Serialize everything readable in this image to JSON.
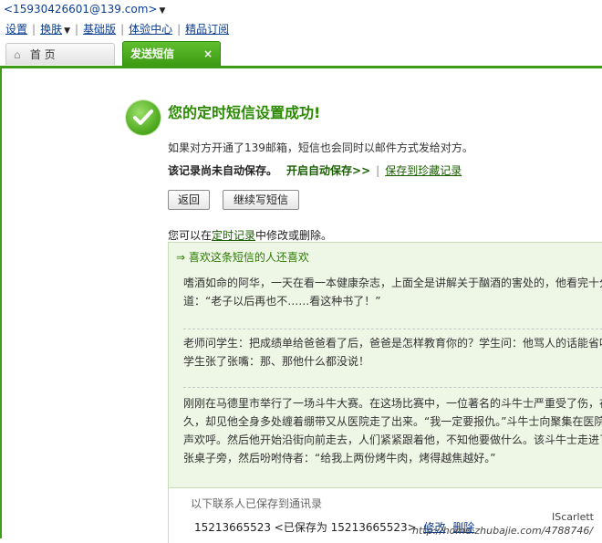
{
  "account": {
    "email": "<15930426601@139.com>"
  },
  "topnav": {
    "items": [
      "设置",
      "换肤",
      "基础版",
      "体验中心",
      "精品订阅"
    ]
  },
  "tabs": {
    "home": "首 页",
    "sms": "发送短信",
    "close": "×"
  },
  "success": {
    "title": "您的定时短信设置成功!",
    "line1": "如果对方开通了139邮箱，短信也会同时以邮件方式发给对方。",
    "not_saved": "该记录尚未自动保存。",
    "auto_save": "开启自动保存>>",
    "save_favorites": "保存到珍藏记录"
  },
  "buttons": {
    "back": "返回",
    "continue": "继续写短信"
  },
  "edit_note": {
    "prefix": "您可以在",
    "link": "定时记录",
    "suffix": "中修改或删除。"
  },
  "recommend": {
    "title": "⇒ 喜欢这条短信的人还喜欢",
    "jokes": [
      [
        "嗜酒如命的阿华，一天在看一本健康杂志，上面全是讲解关于酗酒的害处的，他看完十分",
        "道：“老子以后再也不……看这种书了！”"
      ],
      [
        "老师问学生：把成绩单给爸爸看了后，爸爸是怎样教育你的？学生问：他骂人的话能省吗",
        "学生张了张嘴：那、那他什么都没说！"
      ],
      [
        "刚刚在马德里市举行了一场斗牛大赛。在这场比赛中，一位著名的斗牛士严重受了伤，在",
        "久，却见他全身多处缠着绷带又从医院走了出来。“我一定要报仇。”斗牛士向聚集在医院",
        "声欢呼。然后他开始沿街向前走去，人们紧紧跟着他，不知他要做什么。该斗牛士走进了",
        "张桌子旁，然后吩咐侍者：“给我上两份烤牛肉，烤得越焦越好。”"
      ]
    ]
  },
  "saved": {
    "title": "以下联系人已保存到通讯录",
    "row": "15213665523 <已保存为 15213665523>",
    "edit": "修改",
    "delete": "删除"
  },
  "watermark": {
    "name": "IScarlett",
    "url": "http://home.zhubajie.com/4788746/"
  },
  "colors": {
    "accent_green": "#3e9c16",
    "title_green": "#2a8a00",
    "panel_bg": "#eef7e6"
  }
}
